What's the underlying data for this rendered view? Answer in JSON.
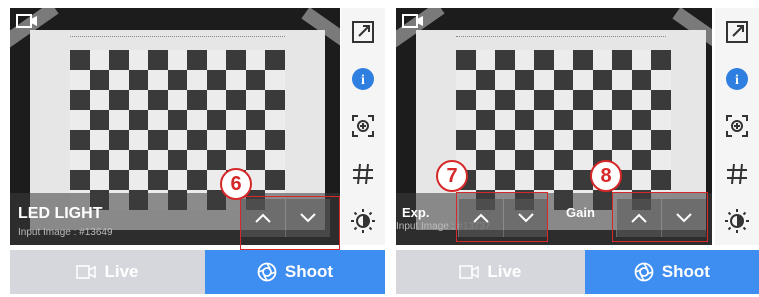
{
  "left": {
    "label": "LED LIGHT",
    "sub_label": "Input Image : #13649",
    "badge": "6"
  },
  "right": {
    "exp_label": "Exp.",
    "gain_label": "Gain",
    "sub_label": "Input Image : #13737",
    "badge_exp": "7",
    "badge_gain": "8"
  },
  "buttons": {
    "live": "Live",
    "shoot": "Shoot"
  },
  "colors": {
    "accent": "#3d8ef0",
    "highlight": "#d62828",
    "info": "#2f7fe0"
  },
  "icons": [
    "camera-icon",
    "expand-icon",
    "info-icon",
    "focus-icon",
    "grid-icon",
    "brightness-icon",
    "chevron-up-icon",
    "chevron-down-icon",
    "video-icon",
    "shutter-icon"
  ]
}
